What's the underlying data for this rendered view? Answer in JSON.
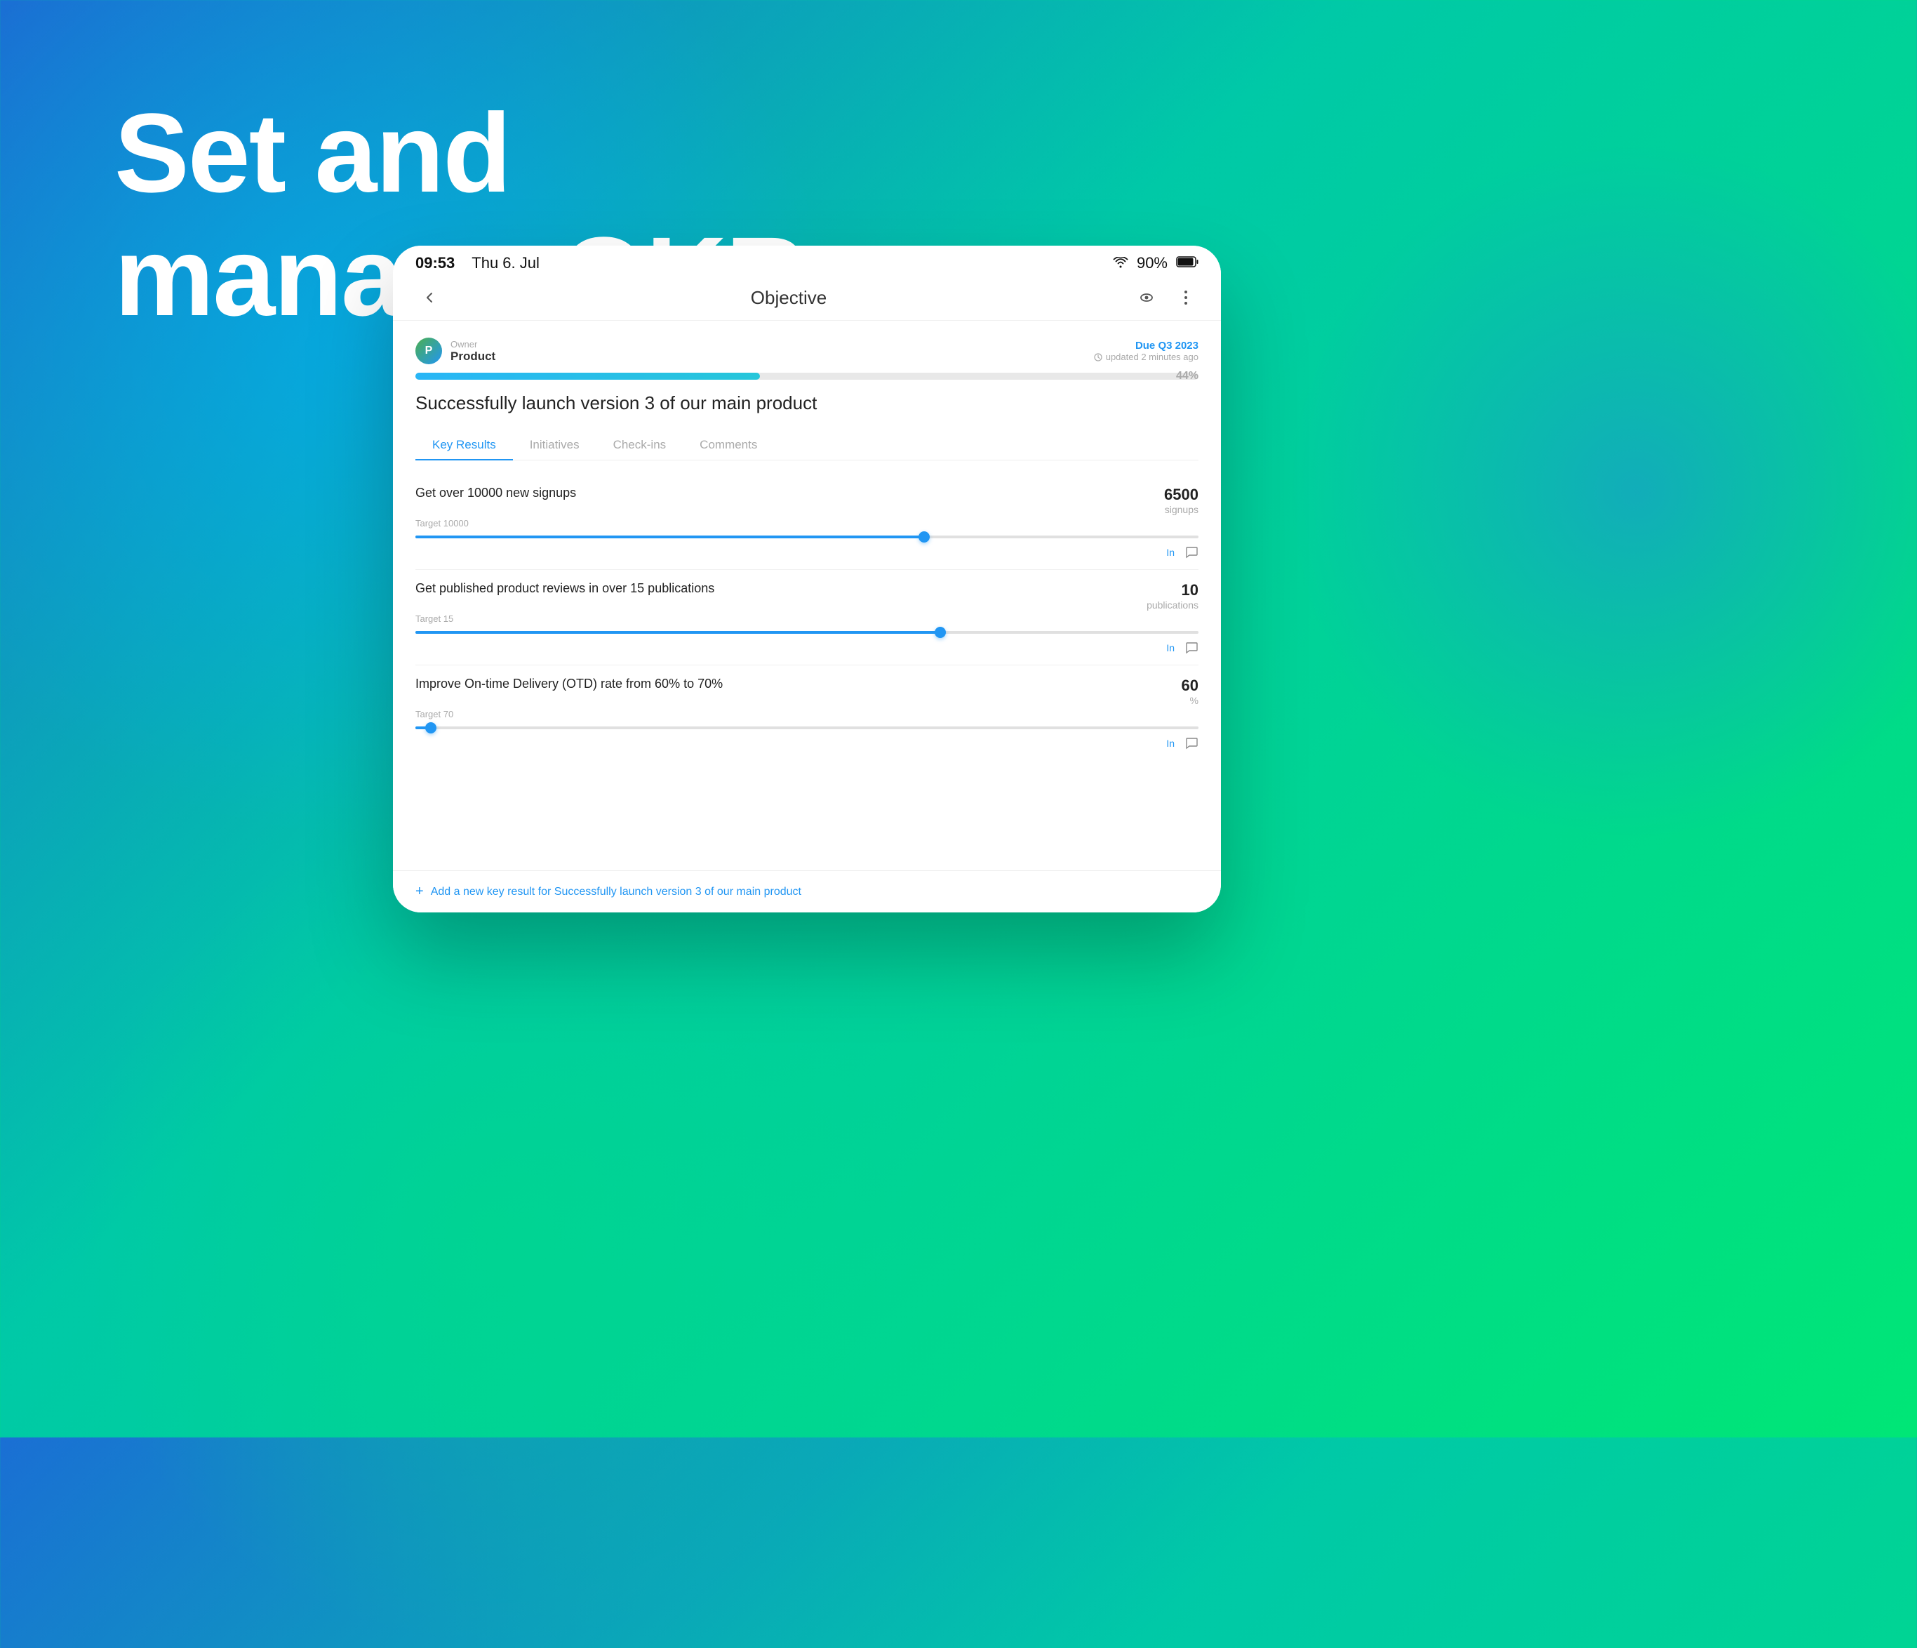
{
  "background": {
    "gradient_start": "#1a6fd4",
    "gradient_end": "#00e676"
  },
  "hero": {
    "line1": "Set and",
    "line2": "manage OKRs"
  },
  "status_bar": {
    "time": "09:53",
    "date": "Thu 6. Jul",
    "wifi": "📶",
    "battery_percent": "90%"
  },
  "app_bar": {
    "title": "Objective",
    "back_icon": "‹",
    "eye_icon": "👁",
    "more_icon": "⋮"
  },
  "objective": {
    "owner_label": "Owner",
    "owner_name": "Product",
    "due_text": "Due Q3 2023",
    "updated_text": "updated 2 minutes ago",
    "progress": 44,
    "progress_label": "44%",
    "title": "Successfully launch version 3 of our main product"
  },
  "tabs": [
    {
      "label": "Key Results",
      "active": true
    },
    {
      "label": "Initiatives",
      "active": false
    },
    {
      "label": "Check-ins",
      "active": false
    },
    {
      "label": "Comments",
      "active": false
    }
  ],
  "key_results": [
    {
      "title": "Get over 10000 new signups",
      "target_label": "Target 10000",
      "current_value": "6500",
      "unit": "signups",
      "fill_percent": 65,
      "thumb_percent": 65
    },
    {
      "title": "Get published product reviews in over 15 publications",
      "target_label": "Target 15",
      "current_value": "10",
      "unit": "publications",
      "fill_percent": 67,
      "thumb_percent": 67
    },
    {
      "title": "Improve On-time Delivery (OTD) rate from 60% to 70%",
      "target_label": "Target 70",
      "current_value": "60",
      "unit": "%",
      "fill_percent": 2,
      "thumb_percent": 2
    }
  ],
  "add_kr": {
    "icon": "+",
    "text": "Add a new key result for Successfully launch version 3 of our main product"
  },
  "actions": {
    "checkin_label": "In",
    "comment_icon": "💬"
  }
}
